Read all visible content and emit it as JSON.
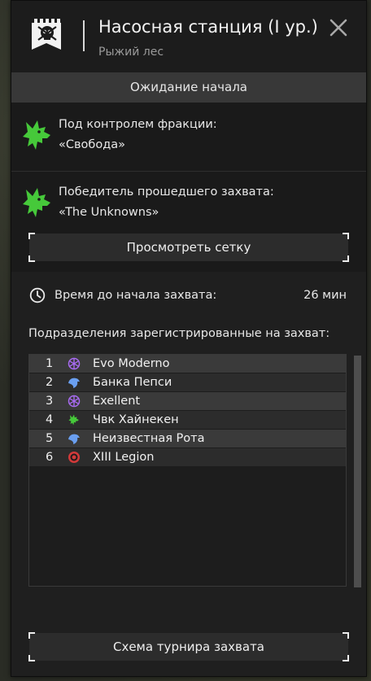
{
  "header": {
    "title": "Насосная станция (I ур.)",
    "subtitle": "Рыжий лес",
    "emblem_icon": "skull-flag-icon",
    "close_icon": "close-icon"
  },
  "status": {
    "text": "Ожидание начала"
  },
  "control": {
    "label": "Под контролем фракции:",
    "faction": "«Свобода»",
    "icon": "green-wolf-icon"
  },
  "previous_winner": {
    "label": "Победитель прошедшего захвата:",
    "faction": "«The Unknowns»",
    "icon": "green-wolf-icon"
  },
  "view_grid_button": "Просмотреть сетку",
  "timer": {
    "label": "Время до начала захвата:",
    "value": "26 мин",
    "icon": "clock-icon"
  },
  "units": {
    "label": "Подразделения зарегистрированные на захват:",
    "rows": [
      {
        "num": "1",
        "name": "Evo Moderno",
        "icon": "purple-atom-icon",
        "color": "#a86bf2"
      },
      {
        "num": "2",
        "name": "Банка Пепси",
        "icon": "blue-bird-icon",
        "color": "#6a9ff0"
      },
      {
        "num": "3",
        "name": "Exellent",
        "icon": "purple-atom-icon",
        "color": "#a86bf2"
      },
      {
        "num": "4",
        "name": "Чвк Хайнекен",
        "icon": "green-wolf-icon",
        "color": "#46c93a"
      },
      {
        "num": "5",
        "name": "Неизвестная Рота",
        "icon": "blue-bird-icon",
        "color": "#6a9ff0"
      },
      {
        "num": "6",
        "name": "XIII Legion",
        "icon": "red-target-icon",
        "color": "#d23a3a"
      }
    ]
  },
  "tournament_button": "Схема турнира захвата",
  "colors": {
    "panel": "#1f1f1f",
    "status_bar": "#383838",
    "faction_green": "#46c93a"
  }
}
